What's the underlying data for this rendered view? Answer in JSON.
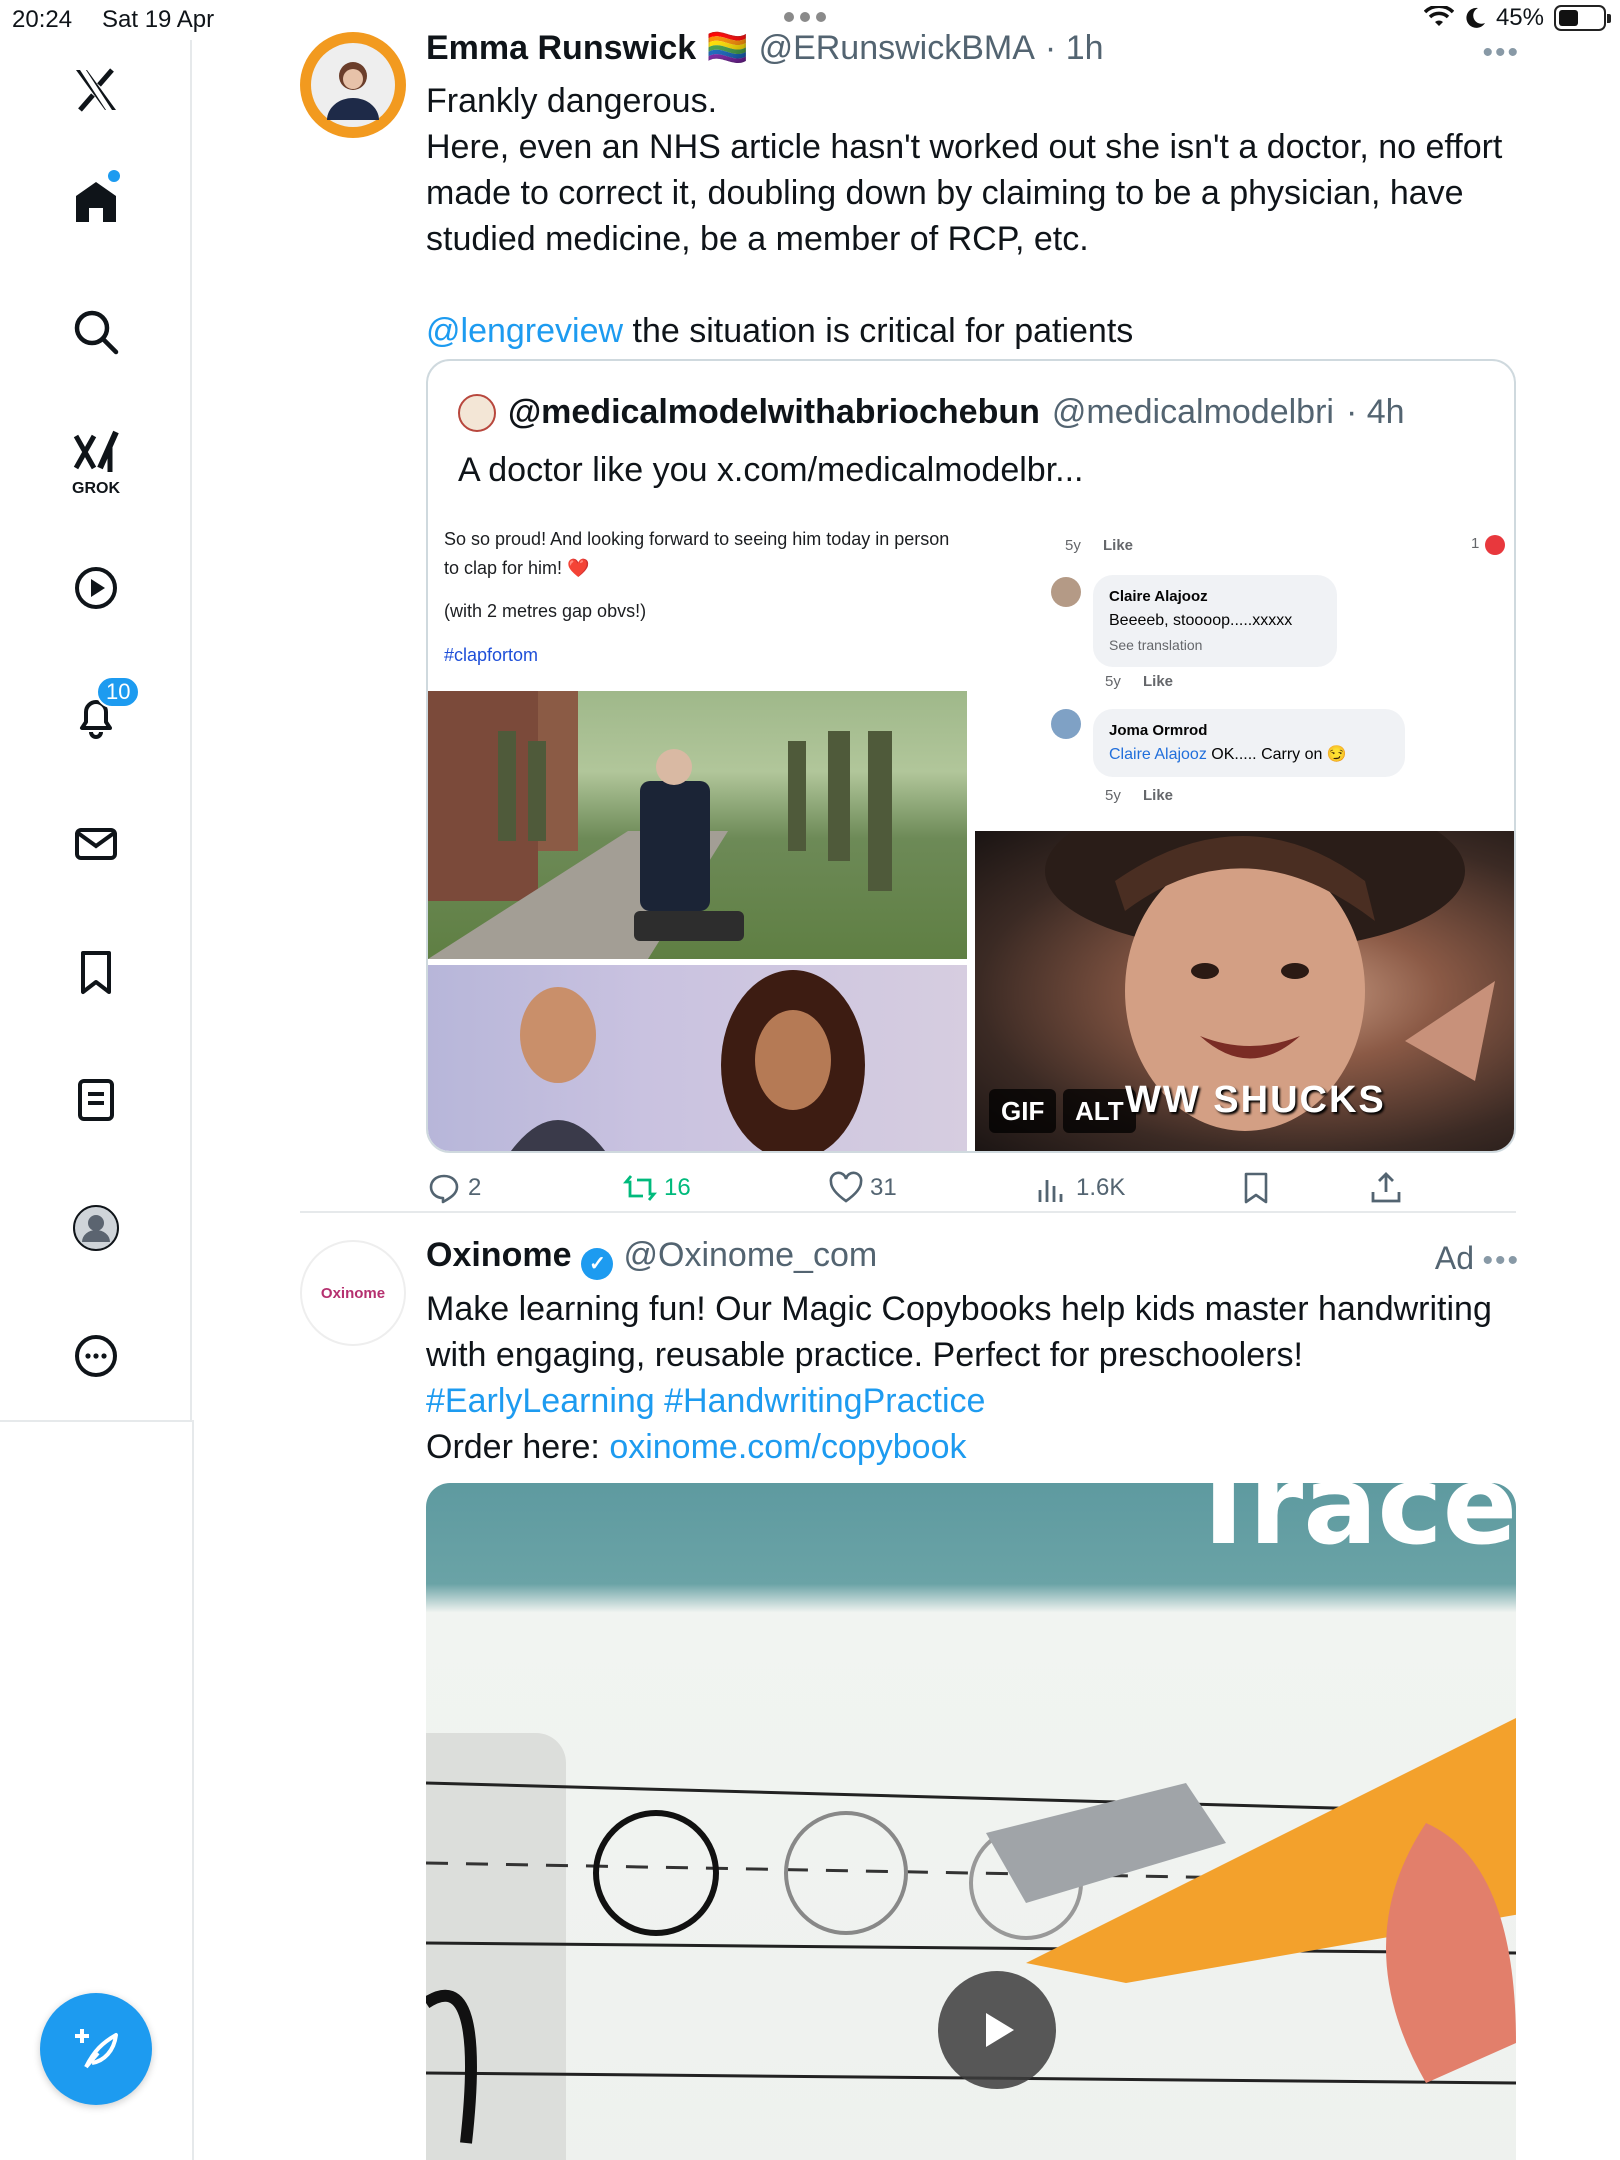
{
  "status": {
    "time": "20:24",
    "date": "Sat 19 Apr",
    "battery": "45%",
    "battery_level": 0.45
  },
  "sidebar": {
    "grok_label": "GROK",
    "notifications_badge": "10",
    "items": [
      "x-logo",
      "home-icon",
      "search-icon",
      "grok-icon",
      "video-icon",
      "bell-icon",
      "mail-icon",
      "bookmark-icon",
      "list-icon",
      "profile-icon",
      "more-icon"
    ]
  },
  "tweet1": {
    "name": "Emma Runswick",
    "flag": "🏳️‍🌈",
    "handle": "@ERunswickBMA",
    "time": "· 1h",
    "line1": "Frankly dangerous.",
    "line2": "Here, even an NHS article hasn't worked out she isn't a doctor, no effort made to correct it, doubling down by claiming to be a physician, have studied medicine, be a member of RCP, etc.",
    "mention": "@lengreview",
    "line3": " the situation is critical for patients",
    "quote": {
      "name": "@medicalmodelwithabriochebun",
      "handle": "@medicalmodelbri",
      "time": "· 4h",
      "text": "A doctor like you x.com/medicalmodelbr...",
      "post_text1": "So so proud! And looking forward to seeing him today in person to clap for him! ❤️",
      "post_text2": "(with 2 metres gap obvs!)",
      "hashtag": "#clapfortom",
      "comments": [
        {
          "meta": "5y",
          "like": "Like",
          "count": "1"
        },
        {
          "name": "Claire Alajooz",
          "text": "Beeeeb, stoooop.....xxxxx",
          "sub": "See translation",
          "meta": "5y",
          "like": "Like"
        },
        {
          "name": "Joma Ormrod",
          "mention": "Claire Alajooz",
          "text": " OK..... Carry on 😏",
          "meta": "5y",
          "like": "Like"
        }
      ],
      "gif_tag": "GIF",
      "alt_tag": "ALT",
      "gif_caption": "WW SHUCKS"
    },
    "stats": {
      "replies": "2",
      "reposts": "16",
      "likes": "31",
      "views": "1.6K"
    },
    "colors": {
      "repost": "#00ba7c",
      "link": "#1d9bf0"
    }
  },
  "tweet2": {
    "name": "Oxinome",
    "handle": "@Oxinome_com",
    "ad": "Ad",
    "avatar_text": "Oxinome",
    "line1": "Make learning fun! Our Magic Copybooks help kids master handwriting with engaging, reusable practice. Perfect for preschoolers!",
    "hashtags": "#EarlyLearning #HandwritingPractice",
    "order_label": "Order here:  ",
    "order_link": "oxinome.com/copybook",
    "media_text": "Trace"
  }
}
